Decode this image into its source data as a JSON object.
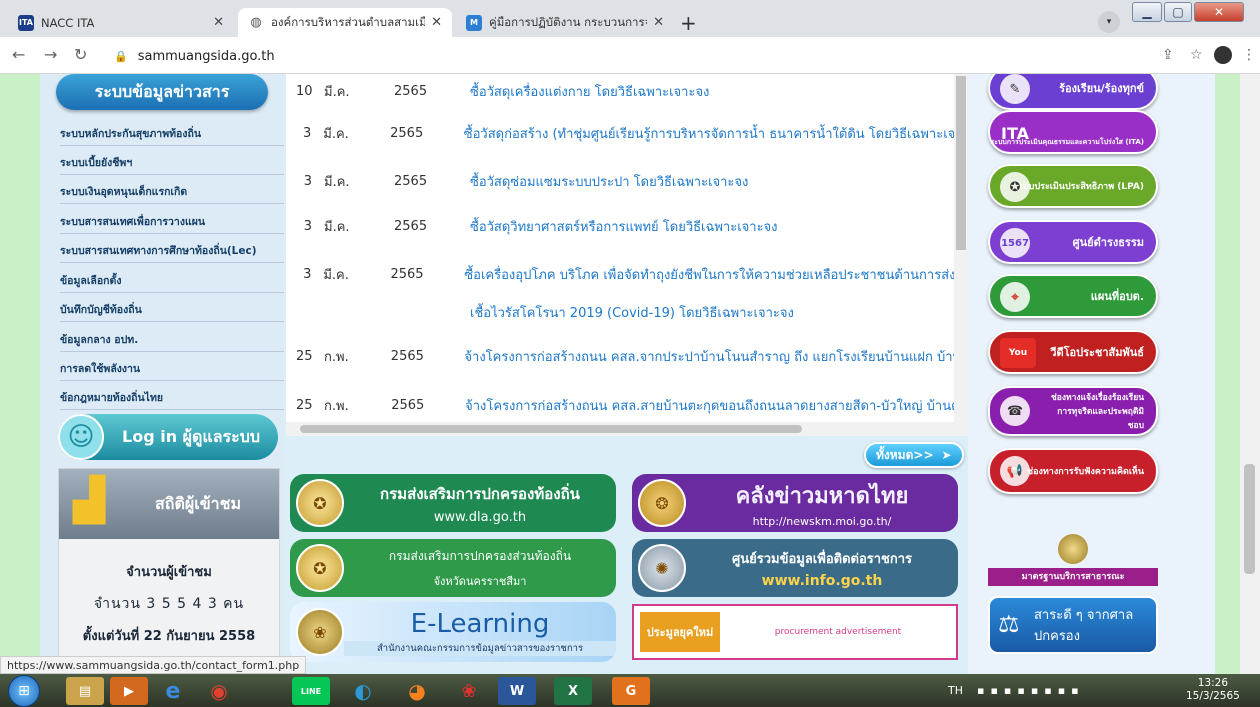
{
  "browser": {
    "tabs": [
      {
        "favicon": "ITA",
        "title": "NACC ITA"
      },
      {
        "favicon": "globe-icon",
        "title": "องค์การบริหารส่วนตำบลสามเมือง อำเภ"
      },
      {
        "favicon": "M",
        "title": "คู่มือการปฏิบัติงาน กระบวนการจัดการเ"
      }
    ],
    "url": "sammuangsida.go.th",
    "status_url": "https://www.sammuangsida.go.th/contact_form1.php"
  },
  "left": {
    "info_heading": "ระบบข้อมูลข่าวสาร",
    "menu": [
      "ระบบหลักประกันสุขภาพท้องถิ่น",
      "ระบบเบี้ยยังชีพฯ",
      "ระบบเงินอุดหนุนเด็กแรกเกิด",
      "ระบบสารสนเทศเพื่อการวางแผน",
      "ระบบสารสนเทศทางการศึกษาท้องถิ่น(Lec)",
      "ข้อมูลเลือกตั้ง",
      "บันทึกบัญชีท้องถิ่น",
      "ข้อมูลกลาง อปท.",
      "การลดใช้พลังงาน",
      "ข้อกฎหมายท้องถิ่นไทย"
    ],
    "login_label": "Log in ผู้ดูแลระบบ",
    "stats_title": "สถิติผู้เข้าชม",
    "visitors_label": "จำนวนผู้เข้าชม",
    "visitors_count": "จำนวน 3 5 5 4 3 คน",
    "since": "ตั้งแต่วันที่ 22 กันยายน 2558"
  },
  "list": [
    {
      "day": "10",
      "month": "มี.ค.",
      "year": "2565",
      "title": "ซื้อวัสดุเครื่องแต่งกาย โดยวิธีเฉพาะเจาะจง"
    },
    {
      "day": "3",
      "month": "มี.ค.",
      "year": "2565",
      "title": "ซื้อวัสดุก่อสร้าง (ทำชุ่มศูนย์เรียนรู้การบริหารจัดการน้ำ ธนาคารน้ำใต้ดิน โดยวิธีเฉพาะเจาะจ"
    },
    {
      "day": "3",
      "month": "มี.ค.",
      "year": "2565",
      "title": "ซื้อวัสดุซ่อมแซมระบบประปา โดยวิธีเฉพาะเจาะจง"
    },
    {
      "day": "3",
      "month": "มี.ค.",
      "year": "2565",
      "title": "ซื้อวัสดุวิทยาศาสตร์หรือการแพทย์ โดยวิธีเฉพาะเจาะจง"
    },
    {
      "day": "3",
      "month": "มี.ค.",
      "year": "2565",
      "title": "ซื้อเครื่องอุปโภค บริโภค เพื่อจัดทำถุงยังชีพในการให้ความช่วยเหลือประชาชนด้านการส่งเสริ"
    },
    {
      "day": "",
      "month": "",
      "year": "",
      "title": "เชื้อไวรัสโคโรนา 2019 (Covid-19) โดยวิธีเฉพาะเจาะจง"
    },
    {
      "day": "25",
      "month": "ก.พ.",
      "year": "2565",
      "title": "จ้างโครงการก่อสร้างถนน คสล.จากประปาบ้านโนนสำราญ ถึง แยกโรงเรียนบ้านแฝก บ้านแฝ"
    },
    {
      "day": "25",
      "month": "ก.พ.",
      "year": "2565",
      "title": "จ้างโครงการก่อสร้างถนน คสล.สายบ้านตะกุดขอนถึงถนนลาดยางสายสีดา-บัวใหญ่ บ้านตะก"
    }
  ],
  "all_button": "ทั้งหมด>>",
  "banners": [
    {
      "line1": "กรมส่งเสริมการปกครองท้องถิ่น",
      "line2": "www.dla.go.th",
      "color": "#1e8a52"
    },
    {
      "line1": "คลังข่าวมหาดไทย",
      "line2": "http://newskm.moi.go.th/",
      "color": "#6a2aa0"
    },
    {
      "line1": "กรมส่งเสริมการปกครองส่วนท้องถิ่น",
      "line2": "จังหวัดนครราชสีมา",
      "color": "#2e9a4a"
    },
    {
      "line1": "ศูนย์รวมข้อมูลเพื่อติดต่อราชการ",
      "line2": "www.info.go.th",
      "color": "#3a6c8a"
    },
    {
      "line1": "E-Learning",
      "line2": "สำนักงานคณะกรรมการข้อมูลข่าวสารของราชการ",
      "color": "#1a6fb5"
    },
    {
      "line1": "ประมูลยุคใหม่",
      "line2": "procurement advertisement",
      "color": "#ffffff"
    }
  ],
  "right_buttons": [
    {
      "label": "ร้องเรียน/ร้องทุกข์",
      "color": "#6b3fd1"
    },
    {
      "label": "ระบบการประเมินคุณธรรมและความโปร่งใส (ITA)",
      "color": "#9a2fc8"
    },
    {
      "label": "แบบประเมินประสิทธิภาพ (LPA)",
      "color": "#6aa82a"
    },
    {
      "label": "ศูนย์ดำรงธรรม",
      "color": "#7d3fd1"
    },
    {
      "label": "แผนที่อบต.",
      "color": "#2e9a3a"
    },
    {
      "label": "วีดีโอประชาสัมพันธ์",
      "color": "#c02020"
    },
    {
      "label": "ช่องทางแจ้งเรื่องร้องเรียน การทุจริตและประพฤติมิชอบ",
      "color": "#8a1fae"
    },
    {
      "label": "ช่องทางการรับฟังความคิดเห็น",
      "color": "#c8202a"
    },
    {
      "label": "มาตรฐานบริการสาธารณะ",
      "color": "#9a1f8a"
    },
    {
      "label": "สาระดี ๆ จากศาลปกครอง",
      "color": "#1a6fb5"
    }
  ],
  "taskbar": {
    "lang": "TH",
    "time": "13:26",
    "date": "15/3/2565"
  }
}
